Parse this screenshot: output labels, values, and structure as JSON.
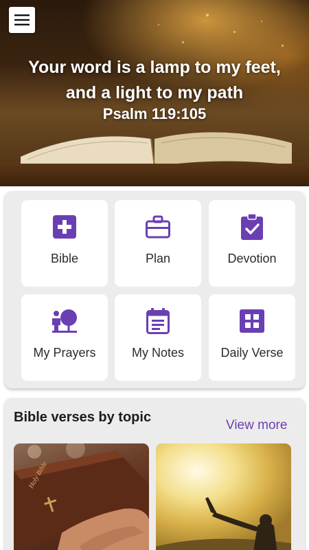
{
  "header": {
    "menu_icon": "hamburger-menu-icon",
    "verse_line1": "Your word is a lamp to my feet,",
    "verse_line2": "and a light to my path",
    "verse_reference": "Psalm 119:105"
  },
  "menu": {
    "accent_color": "#6a3fb3",
    "items": [
      {
        "label": "Bible",
        "icon": "plus-box-icon"
      },
      {
        "label": "Plan",
        "icon": "briefcase-icon"
      },
      {
        "label": "Devotion",
        "icon": "clipboard-check-icon"
      },
      {
        "label": "My Prayers",
        "icon": "prayer-icon"
      },
      {
        "label": "My Notes",
        "icon": "calendar-notes-icon"
      },
      {
        "label": "Daily Verse",
        "icon": "grid-icon"
      }
    ]
  },
  "topics": {
    "title": "Bible verses by topic",
    "view_more": "View more",
    "cards": [
      {
        "image": "hands-holding-bible-image",
        "book_label": "Holy Bible"
      },
      {
        "image": "person-raising-hands-sunlight-image"
      }
    ]
  }
}
